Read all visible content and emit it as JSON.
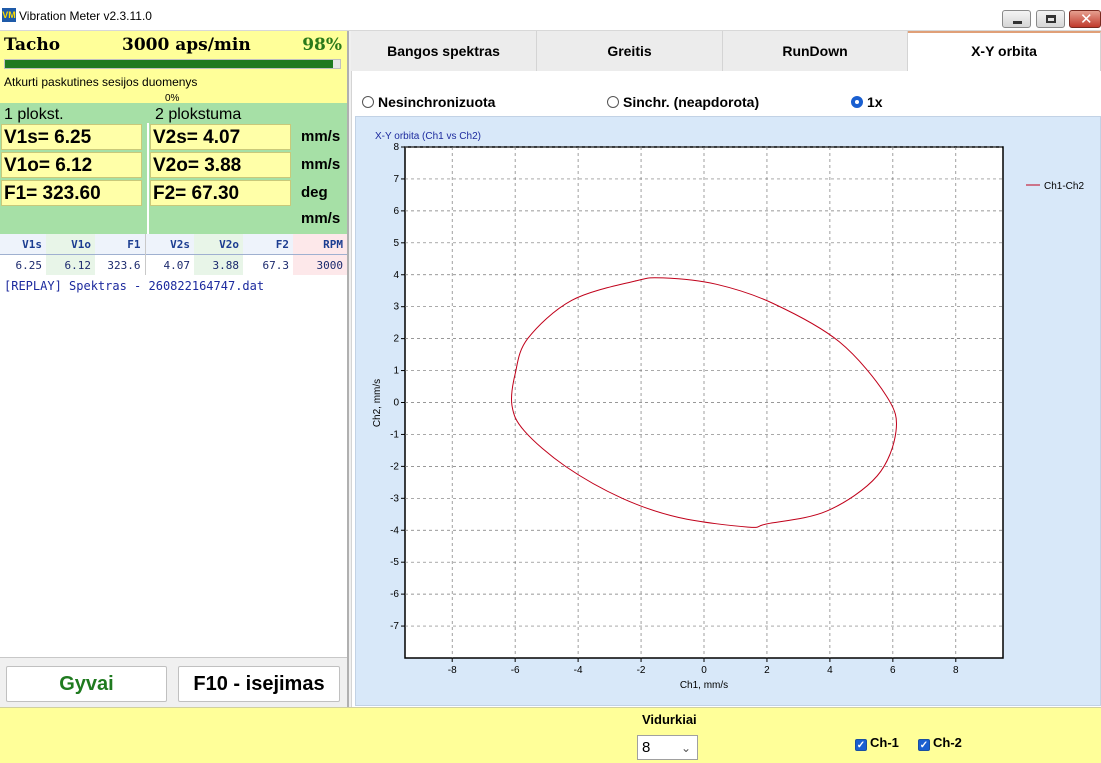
{
  "window": {
    "title": "Vibration Meter v2.3.11.0",
    "icon": "app-logo-icon"
  },
  "tacho": {
    "label": "Tacho",
    "rpm_text": "3000 aps/min",
    "percent_text": "98%",
    "progress": 0.98,
    "message": "Atkurti paskutines sesijos duomenys",
    "sub_percent": "0%"
  },
  "plane1": {
    "title": "1 plokst.",
    "v_s": "V1s= 6.25",
    "v_o": "V1o= 6.12",
    "f": "F1= 323.60"
  },
  "plane2": {
    "title": "2 plokstuma",
    "v_s": "V2s= 4.07",
    "v_o": "V2o= 3.88",
    "f": "F2= 67.30"
  },
  "units": [
    "mm/s",
    "mm/s",
    "deg",
    "mm/s"
  ],
  "summary": {
    "headers": [
      "V1s",
      "V1o",
      "F1",
      "V2s",
      "V2o",
      "F2",
      "RPM"
    ],
    "values": [
      "6.25",
      "6.12",
      "323.6",
      "4.07",
      "3.88",
      "67.3",
      "3000"
    ]
  },
  "log": "[REPLAY] Spektras - 260822164747.dat",
  "buttons": {
    "live": "Gyvai",
    "exit": "F10 - isejimas"
  },
  "tabs": [
    "Bangos spektras",
    "Greitis",
    "RunDown",
    "X-Y orbita"
  ],
  "active_tab": "X-Y orbita",
  "radios": {
    "items": [
      "Nesinchronizuota",
      "Sinchr. (neapdorota)",
      "1x"
    ],
    "selected": "1x"
  },
  "bottom": {
    "avg_label": "Vidurkiai",
    "avg_value": "8",
    "ch1": "Ch-1",
    "ch2": "Ch-2",
    "ch1_checked": true,
    "ch2_checked": true
  },
  "colors": {
    "accent": "#1a5fd0",
    "orbit": "#c0001a",
    "tacho_bg": "#ffff99",
    "readings_bg": "#a6e0a6"
  },
  "chart_data": {
    "type": "line",
    "title": "X-Y orbita (Ch1 vs Ch2)",
    "xlabel": "Ch1, mm/s",
    "ylabel": "Ch2, mm/s",
    "xlim": [
      -9.5,
      9.5
    ],
    "ylim": [
      -8,
      8
    ],
    "x_ticks": [
      -8,
      -6,
      -4,
      -2,
      0,
      2,
      4,
      6,
      8
    ],
    "y_ticks": [
      -7,
      -6,
      -5,
      -4,
      -3,
      -2,
      -1,
      0,
      1,
      2,
      3,
      4,
      5,
      6,
      7,
      8
    ],
    "grid": true,
    "legend_position": "top-right",
    "series": [
      {
        "name": "Ch1-Ch2",
        "color": "#c0001a",
        "x": [
          -6.0,
          -5.6,
          -4.2,
          -2.2,
          -1.3,
          0.4,
          2.2,
          4.3,
          5.8,
          6.1,
          5.5,
          3.9,
          2.0,
          1.4,
          -0.8,
          -2.6,
          -4.4,
          -5.7,
          -6.1,
          -6.0
        ],
        "y": [
          0.9,
          2.0,
          3.2,
          3.8,
          3.9,
          3.7,
          3.1,
          1.9,
          0.2,
          -0.9,
          -2.3,
          -3.4,
          -3.8,
          -3.9,
          -3.6,
          -3.0,
          -2.0,
          -0.9,
          -0.1,
          0.9
        ]
      }
    ]
  }
}
